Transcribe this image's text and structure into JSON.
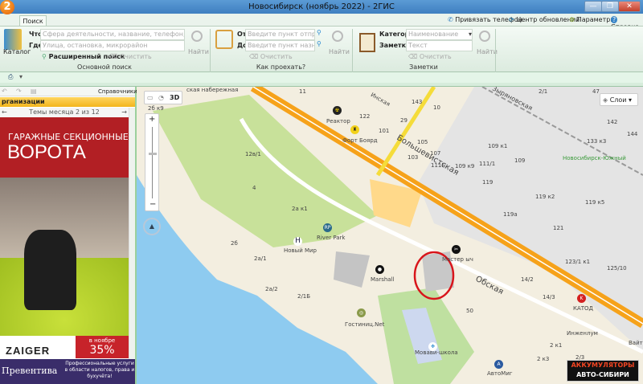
{
  "window": {
    "title": "Новосибирск (ноябрь 2022) - 2ГИС",
    "logo": "2",
    "minimize": "—",
    "maximize": "❐",
    "close": "✕"
  },
  "tabs": [
    {
      "label": "Поиск"
    }
  ],
  "top_links": [
    {
      "label": "Привязать телефон",
      "icon": "phone-icon"
    },
    {
      "label": "Центр обновлений",
      "icon": "refresh-icon"
    },
    {
      "label": "Параметры",
      "icon": "gear-icon"
    },
    {
      "label": "Справка",
      "icon": "help-icon"
    }
  ],
  "search": {
    "catalog": "Каталог",
    "what_label": "Что",
    "what_placeholder": "Сфера деятельности, название, телефон, маршрут",
    "where_label": "Где",
    "where_placeholder": "Улица, остановка, микрорайон",
    "advanced": "Расширенный поиск",
    "clear": "Очистить",
    "find": "Найти",
    "group": "Основной поиск"
  },
  "route": {
    "from_label": "От",
    "from_placeholder": "Введите пункт отправления",
    "to_label": "До",
    "to_placeholder": "Введите пункт назначения",
    "clear": "Очистить",
    "find": "Найти",
    "group": "Как проехать?"
  },
  "notes": {
    "category_label": "Категория",
    "category_value": "Наименование",
    "note_label": "Заметка",
    "note_placeholder": "Текст",
    "clear": "Очистить",
    "find": "Найти",
    "group": "Заметки"
  },
  "left_panel": {
    "directories": "Справочники",
    "section": "рганизации",
    "themes": "Темы месяца 2 из 12",
    "ad": {
      "line1": "ГАРАЖНЫЕ СЕКЦИОННЫЕ",
      "line2": "ВОРОТА",
      "brand": "ZAIGER",
      "month": "в ноябре",
      "discount": "35%"
    },
    "ad2": {
      "brand": "Превентива",
      "text": "Профессиональные услуги в области налогов, права и бухучёта!"
    }
  },
  "map": {
    "layers": "Слои",
    "mode3d": "3D",
    "banner_line1": "АККУМУЛЯТОРЫ",
    "banner_line2": "АВТО-СИБИРИ",
    "streets": [
      "Большевистская",
      "Обская",
      "Зыряновская",
      "Инская",
      "ская набережная"
    ],
    "pois": [
      "Реактор",
      "Форт Боярд",
      "River Park",
      "Новый Мир",
      "Marshall",
      "Мастер ыч",
      "Гостиниц.Net",
      "Мовави-школа",
      "АвтоМиг",
      "Инженлум",
      "КАТОД",
      "Новосибирск-Южный",
      "Вайт"
    ],
    "houses": [
      "11",
      "143",
      "122",
      "29",
      "101",
      "10",
      "105",
      "107",
      "103",
      "111Б",
      "109 к9",
      "111/1",
      "119",
      "109 к1",
      "109",
      "119 к2",
      "119 к5",
      "119а",
      "2/1",
      "47",
      "142",
      "144",
      "133 к3",
      "12в/1",
      "4",
      "2а к1",
      "2б",
      "2а/1",
      "2а/2",
      "2/1Б",
      "50",
      "14/2",
      "14/3",
      "121",
      "123/1 к1",
      "125/10",
      "2 к1",
      "2 к3",
      "2/3",
      "2б к9"
    ]
  }
}
